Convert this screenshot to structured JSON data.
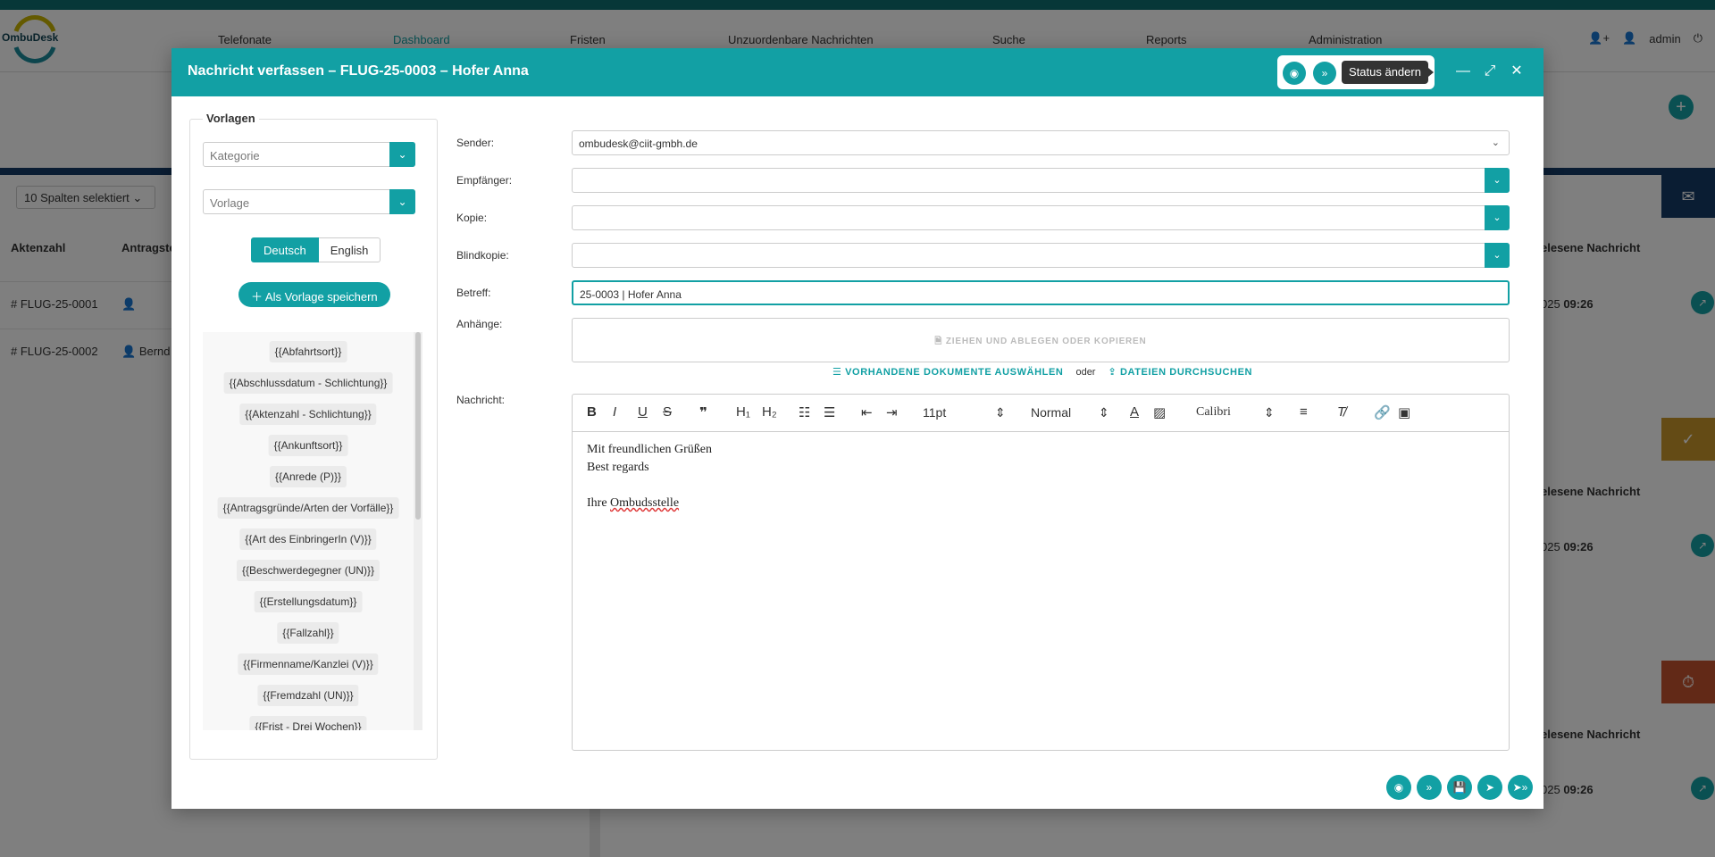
{
  "app": {
    "logo_text": "OmbuDesk",
    "nav": [
      "Telefonate",
      "Dashboard",
      "Fristen",
      "Unzuordenbare Nachrichten",
      "Suche",
      "Reports",
      "Administration"
    ],
    "user": "admin",
    "spalten_select": "10 Spalten selektiert",
    "table_headers": {
      "aktenzahl": "Aktenzahl",
      "antragsteller": "Antragste"
    },
    "rows": [
      {
        "aktenzahl": "FLUG-25-0001",
        "name": ""
      },
      {
        "aktenzahl": "FLUG-25-0002",
        "name": "Bernd"
      }
    ],
    "right_col_header": "elesene Nachricht",
    "right_time_prefix": "025",
    "right_time": "09:26"
  },
  "modal": {
    "title": "Nachricht verfassen – FLUG-25-0003 – Hofer Anna",
    "tooltip": "Status ändern",
    "vorlagen": {
      "legend": "Vorlagen",
      "kategorie_placeholder": "Kategorie",
      "vorlage_placeholder": "Vorlage",
      "lang_de": "Deutsch",
      "lang_en": "English",
      "save_label": "Als Vorlage speichern",
      "tags": [
        "{{Abfahrtsort}}",
        "{{Abschlussdatum - Schlichtung}}",
        "{{Aktenzahl - Schlichtung}}",
        "{{Ankunftsort}}",
        "{{Anrede (P)}}",
        "{{Antragsgründe/Arten der Vorfälle}}",
        "{{Art des EinbringerIn (V)}}",
        "{{Beschwerdegegner (UN)}}",
        "{{Erstellungsdatum}}",
        "{{Fallzahl}}",
        "{{Firmenname/Kanzlei (V)}}",
        "{{Fremdzahl (UN)}}",
        "{{Frist - Drei Wochen}}"
      ]
    },
    "form": {
      "sender_label": "Sender:",
      "sender_value": "ombudesk@ciit-gmbh.de",
      "empfaenger_label": "Empfänger:",
      "kopie_label": "Kopie:",
      "blindkopie_label": "Blindkopie:",
      "betreff_label": "Betreff:",
      "betreff_value": "25-0003 | Hofer Anna",
      "anhaenge_label": "Anhänge:",
      "drop_text": "ZIEHEN UND ABLEGEN ODER KOPIEREN",
      "select_docs": "VORHANDENE DOKUMENTE AUSWÄHLEN",
      "oder": "oder",
      "browse_files": "DATEIEN DURCHSUCHEN",
      "nachricht_label": "Nachricht:"
    },
    "editor": {
      "font_size": "11pt",
      "style": "Normal",
      "font": "Calibri",
      "lines": [
        "Mit freundlichen Grüßen",
        "Best regards",
        "",
        "Ihre "
      ],
      "spell_word": "Ombudsstelle"
    },
    "colors": {
      "accent": "#12a0a4",
      "header": "#12a0a4",
      "navy": "#153b66"
    }
  }
}
